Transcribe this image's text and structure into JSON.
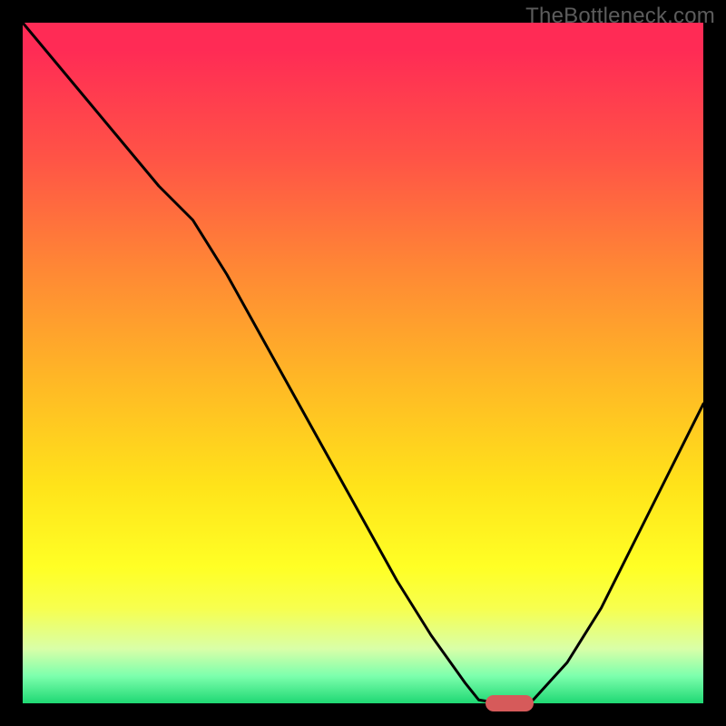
{
  "watermark": "TheBottleneck.com",
  "colors": {
    "background": "#000000",
    "gradient_top": "#ff2b55",
    "gradient_mid": "#ffe31a",
    "gradient_bottom": "#1fd873",
    "curve": "#000000",
    "marker": "#d65a5a",
    "watermark": "#5c5c5c"
  },
  "chart_data": {
    "type": "line",
    "title": "",
    "xlabel": "",
    "ylabel": "",
    "xlim": [
      0,
      100
    ],
    "ylim": [
      0,
      100
    ],
    "grid": false,
    "legend": false,
    "series": [
      {
        "name": "bottleneck-curve",
        "x": [
          0,
          5,
          10,
          15,
          20,
          25,
          30,
          35,
          40,
          45,
          50,
          55,
          60,
          65,
          67,
          70,
          73,
          75,
          80,
          85,
          90,
          95,
          100
        ],
        "values": [
          100,
          94,
          88,
          82,
          76,
          71,
          63,
          54,
          45,
          36,
          27,
          18,
          10,
          3,
          0.5,
          0,
          0,
          0.5,
          6,
          14,
          24,
          34,
          44
        ]
      }
    ],
    "marker": {
      "name": "optimal-range",
      "x_center": 71.5,
      "y": 0,
      "x_start": 68,
      "x_end": 75
    },
    "annotations": [
      {
        "text": "TheBottleneck.com",
        "position": "top-right"
      }
    ]
  }
}
